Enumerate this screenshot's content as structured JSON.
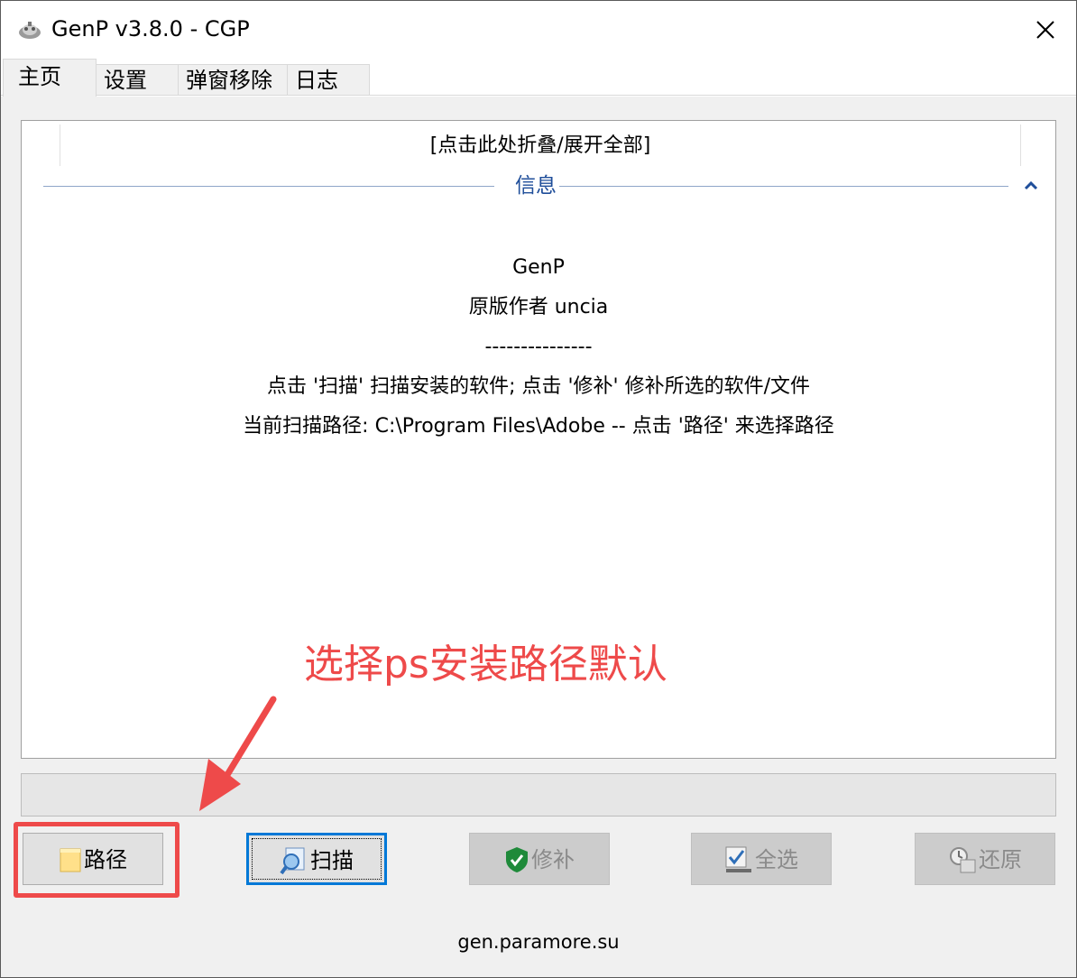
{
  "window": {
    "title": "GenP v3.8.0 - CGP",
    "close_icon": "close-icon",
    "app_icon": "app-icon"
  },
  "tabs": [
    {
      "label": "主页",
      "active": true
    },
    {
      "label": "设置",
      "active": false
    },
    {
      "label": "弹窗移除",
      "active": false
    },
    {
      "label": "日志",
      "active": false
    }
  ],
  "panel": {
    "collapse_toggle": "[点击此处折叠/展开全部]",
    "section_title": "信息",
    "section_caret_icon": "chevron-up-icon",
    "lines": [
      "GenP",
      "原版作者 uncia",
      "---------------",
      "点击 '扫描' 扫描安装的软件; 点击 '修补' 修补所选的软件/文件",
      "当前扫描路径: C:\\Program Files\\Adobe -- 点击 '路径' 来选择路径"
    ]
  },
  "annotation": {
    "text": "选择ps安装路径默认",
    "color": "#ee4a4a"
  },
  "progress": {
    "value": 0
  },
  "buttons": [
    {
      "label": "路径",
      "icon": "folder-icon",
      "enabled": true,
      "focused": false
    },
    {
      "label": "扫描",
      "icon": "magnifier-icon",
      "enabled": true,
      "focused": true
    },
    {
      "label": "修补",
      "icon": "shield-check-icon",
      "enabled": false,
      "focused": false
    },
    {
      "label": "全选",
      "icon": "checklist-icon",
      "enabled": false,
      "focused": false
    },
    {
      "label": "还原",
      "icon": "restore-icon",
      "enabled": false,
      "focused": false
    }
  ],
  "footer": {
    "text": "gen.paramore.su"
  },
  "colors": {
    "accent": "#0078d7",
    "section_title": "#1f4e9a",
    "annotation": "#ee4a4a"
  }
}
